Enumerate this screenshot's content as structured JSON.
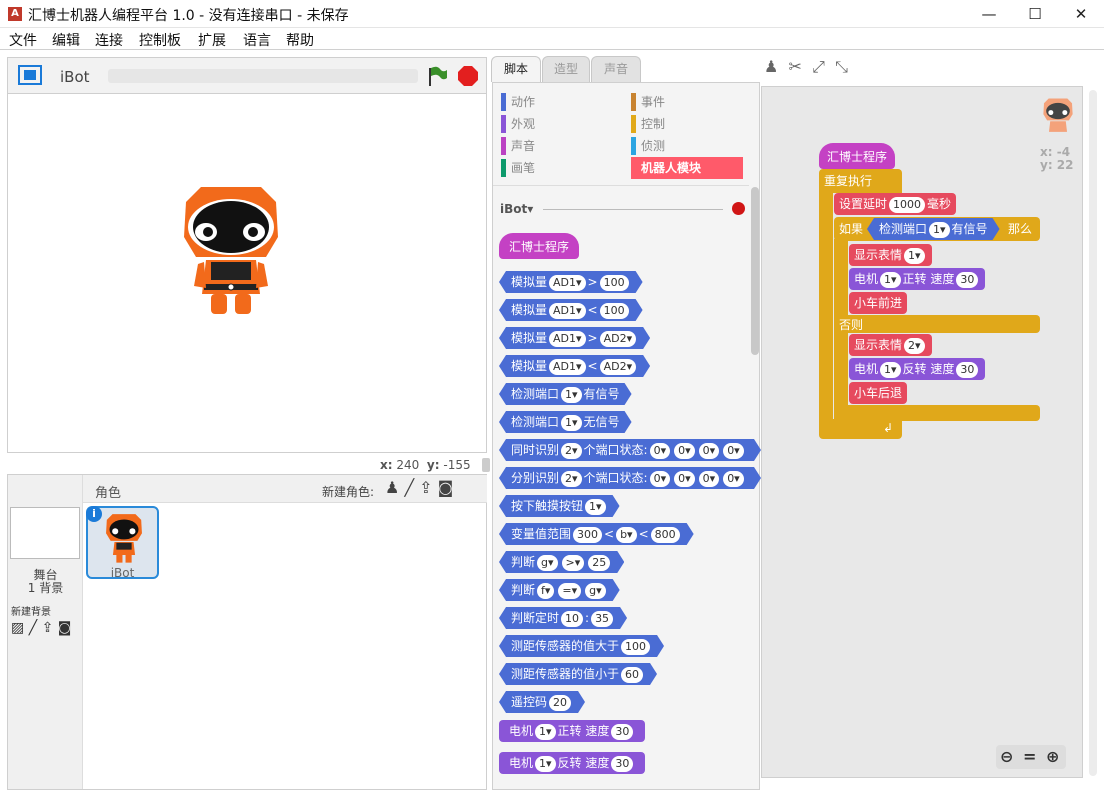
{
  "window": {
    "title": "汇博士机器人编程平台 1.0 - 没有连接串口 - 未保存",
    "minimize": "—",
    "maximize": "☐",
    "close": "✕"
  },
  "menu": [
    "文件",
    "编辑",
    "连接",
    "控制板",
    "扩展",
    "语言",
    "帮助"
  ],
  "stage": {
    "sprite_name": "iBot",
    "x_label": "x:",
    "x_value": "240",
    "y_label": "y:",
    "y_value": "-155"
  },
  "sprites_pane": {
    "header": "角色",
    "new_sprite_label": "新建角色:",
    "stage_label": "舞台",
    "backdrop_count": "1 背景",
    "new_backdrop_label": "新建背景",
    "sprite_name": "iBot"
  },
  "tabs": [
    "脚本",
    "造型",
    "声音"
  ],
  "categories": [
    {
      "label": "动作",
      "color": "#4a6cd4"
    },
    {
      "label": "事件",
      "color": "#c88330"
    },
    {
      "label": "外观",
      "color": "#8a55d7"
    },
    {
      "label": "控制",
      "color": "#e1a91a"
    },
    {
      "label": "声音",
      "color": "#bb42c3"
    },
    {
      "label": "侦测",
      "color": "#2ca5e2"
    },
    {
      "label": "画笔",
      "color": "#0e9a6c"
    },
    {
      "label": "机器人模块",
      "color": "#ff5a6a"
    }
  ],
  "palette": {
    "device_label": "iBot",
    "hat": "汇博士程序",
    "blocks": [
      {
        "t": "模拟量",
        "s1": "AD1▾",
        "op": ">",
        "s2": "100"
      },
      {
        "t": "模拟量",
        "s1": "AD1▾",
        "op": "<",
        "s2": "100"
      },
      {
        "t": "模拟量",
        "s1": "AD1▾",
        "op": ">",
        "s2": "AD2▾"
      },
      {
        "t": "模拟量",
        "s1": "AD1▾",
        "op": "<",
        "s2": "AD2▾"
      },
      {
        "t": "检测端口",
        "s1": "1▾",
        "op": "有信号",
        "s2": ""
      },
      {
        "t": "检测端口",
        "s1": "1▾",
        "op": "无信号",
        "s2": ""
      }
    ],
    "sync_label": "同时识别",
    "sep_label": "分别识别",
    "ports_label": "个端口状态:",
    "two": "2▾",
    "zero": "0▾",
    "touch": "按下触摸按钮",
    "one": "1▾",
    "range": {
      "t": "变量值范围",
      "a": "300",
      "b": "b▾",
      "c": "800"
    },
    "judge1": {
      "t": "判断",
      "a": "g▾",
      "op": ">▾",
      "b": "25"
    },
    "judge2": {
      "t": "判断",
      "a": "f▾",
      "op": "=▾",
      "b": "g▾"
    },
    "timer": {
      "t": "判断定时",
      "a": "10",
      "b": "35"
    },
    "dist_gt": {
      "t": "测距传感器的值大于",
      "v": "100"
    },
    "dist_lt": {
      "t": "测距传感器的值小于",
      "v": "60"
    },
    "remote": {
      "t": "遥控码",
      "v": "20"
    },
    "motor_f": {
      "t": "电机",
      "p": "1▾",
      "d": "正转",
      "s": "速度",
      "v": "30"
    },
    "motor_r": {
      "t": "电机",
      "p": "1▾",
      "d": "反转",
      "s": "速度",
      "v": "30"
    }
  },
  "script": {
    "sprite_x": "x: -4",
    "sprite_y": "y: 22",
    "hat": "汇博士程序",
    "forever": "重复执行",
    "delay": {
      "t": "设置延时",
      "v": "1000",
      "u": "毫秒"
    },
    "if": "如果",
    "check": {
      "t": "检测端口",
      "p": "1▾",
      "c": "有信号"
    },
    "then": "那么",
    "face1": {
      "t": "显示表情",
      "v": "1▾"
    },
    "motor1": {
      "t": "电机",
      "p": "1▾",
      "d": "正转",
      "s": "速度",
      "v": "30"
    },
    "forward": "小车前进",
    "else": "否则",
    "face2": {
      "t": "显示表情",
      "v": "2▾"
    },
    "motor2": {
      "t": "电机",
      "p": "1▾",
      "d": "反转",
      "s": "速度",
      "v": "30"
    },
    "back": "小车后退"
  }
}
